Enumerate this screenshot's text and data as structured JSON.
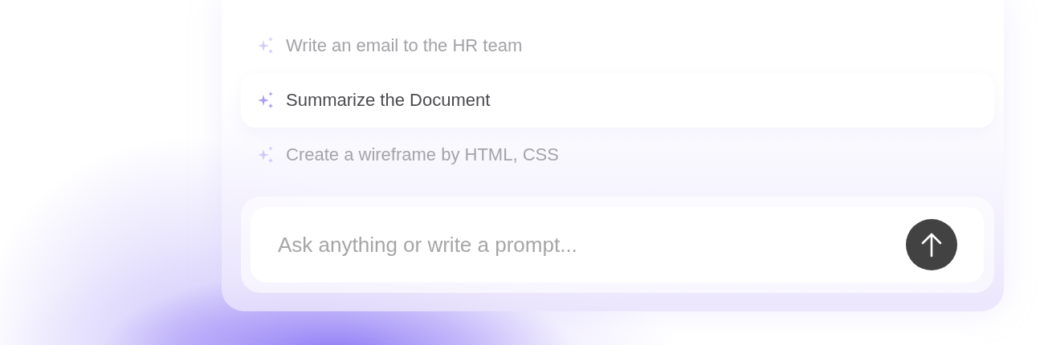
{
  "suggestions": [
    {
      "label": "Write an email to the HR team",
      "selected": false
    },
    {
      "label": "Summarize the Document",
      "selected": true
    },
    {
      "label": "Create a wireframe by HTML, CSS",
      "selected": false
    }
  ],
  "prompt": {
    "placeholder": "Ask anything or write a prompt..."
  }
}
